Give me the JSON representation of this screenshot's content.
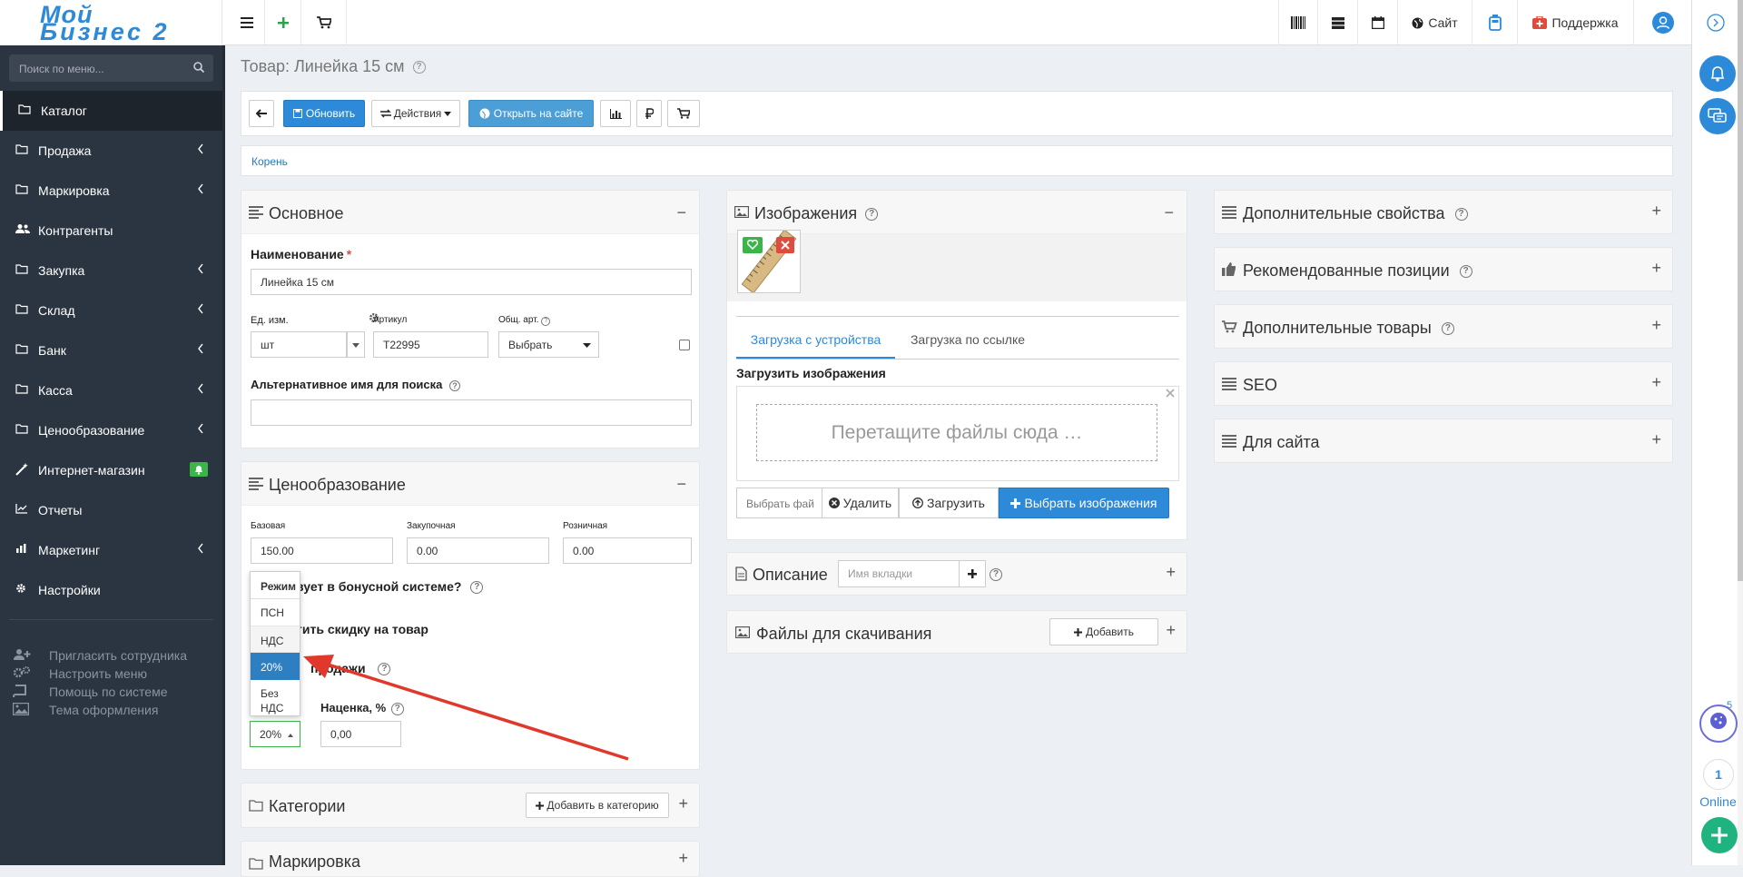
{
  "logo": {
    "line1": "Мой",
    "line2": "Бизнес 2"
  },
  "topbar": {
    "site_label": "Сайт",
    "support_label": "Поддержка"
  },
  "sidebar": {
    "search_placeholder": "Поиск по меню...",
    "items": [
      {
        "label": "Каталог"
      },
      {
        "label": "Продажа"
      },
      {
        "label": "Маркировка"
      },
      {
        "label": "Контрагенты"
      },
      {
        "label": "Закупка"
      },
      {
        "label": "Склад"
      },
      {
        "label": "Банк"
      },
      {
        "label": "Касса"
      },
      {
        "label": "Ценообразование"
      },
      {
        "label": "Интернет-магазин"
      },
      {
        "label": "Отчеты"
      },
      {
        "label": "Маркетинг"
      },
      {
        "label": "Настройки"
      }
    ],
    "links": [
      {
        "label": "Пригласить сотрудника"
      },
      {
        "label": "Настроить меню"
      },
      {
        "label": "Помощь по системе"
      },
      {
        "label": "Тема оформления"
      }
    ]
  },
  "page": {
    "title": "Товар: Линейка 15 см"
  },
  "toolbar": {
    "update": "Обновить",
    "actions": "Действия",
    "open_site": "Открыть на сайте"
  },
  "breadcrumb": {
    "root": "Корень"
  },
  "basic": {
    "title": "Основное",
    "name_label": "Наименование",
    "name_value": "Линейка 15 см",
    "unit_label": "Ед. изм.",
    "unit_value": "шт",
    "article_label": "Артикул",
    "article_value": "Т22995",
    "common_article_label": "Общ. арт.",
    "common_article_value": "Выбрать",
    "alt_name_label": "Альтернативное имя для поиска",
    "alt_name_value": ""
  },
  "pricing": {
    "title": "Ценообразование",
    "base_label": "Базовая",
    "base_value": "150.00",
    "purchase_label": "Закупочная",
    "purchase_value": "0.00",
    "retail_label": "Розничная",
    "retail_value": "0.00",
    "bonus_text": "вует в бонусной системе?",
    "discount_text": "тить скидку на товар",
    "sales_text": "продажи",
    "markup_label": "Наценка, %",
    "markup_value": "0,00",
    "vat_value": "20%",
    "dropdown": {
      "header": "Режим",
      "options": [
        "ПСН",
        "НДС",
        "20%",
        "Без НДС"
      ],
      "selected": "20%"
    }
  },
  "categories": {
    "title": "Категории",
    "add_button": "Добавить в категорию"
  },
  "marking": {
    "title": "Маркировка"
  },
  "images": {
    "title": "Изображения",
    "tab_device": "Загрузка с устройства",
    "tab_link": "Загрузка по ссылке",
    "upload_label": "Загрузить изображения",
    "drop_text": "Перетащите файлы сюда …",
    "file_placeholder": "Выбрать фай",
    "delete": "Удалить",
    "upload": "Загрузить",
    "choose": "Выбрать изображения"
  },
  "description": {
    "title": "Описание",
    "tab_placeholder": "Имя вкладки"
  },
  "downloads": {
    "title": "Файлы для скачивания",
    "add": "Добавить"
  },
  "right_panels": [
    {
      "title": "Дополнительные свойства"
    },
    {
      "title": "Рекомендованные позиции"
    },
    {
      "title": "Дополнительные товары"
    },
    {
      "title": "SEO"
    },
    {
      "title": "Для сайта"
    }
  ],
  "rail": {
    "badge_count": "5",
    "online_count": "1",
    "online_label": "Online"
  },
  "colors": {
    "accent": "#2d8ad8",
    "sidebar": "#2b3541",
    "success": "#3bb54a",
    "danger": "#e04b3f",
    "arrow": "#e0392b"
  }
}
